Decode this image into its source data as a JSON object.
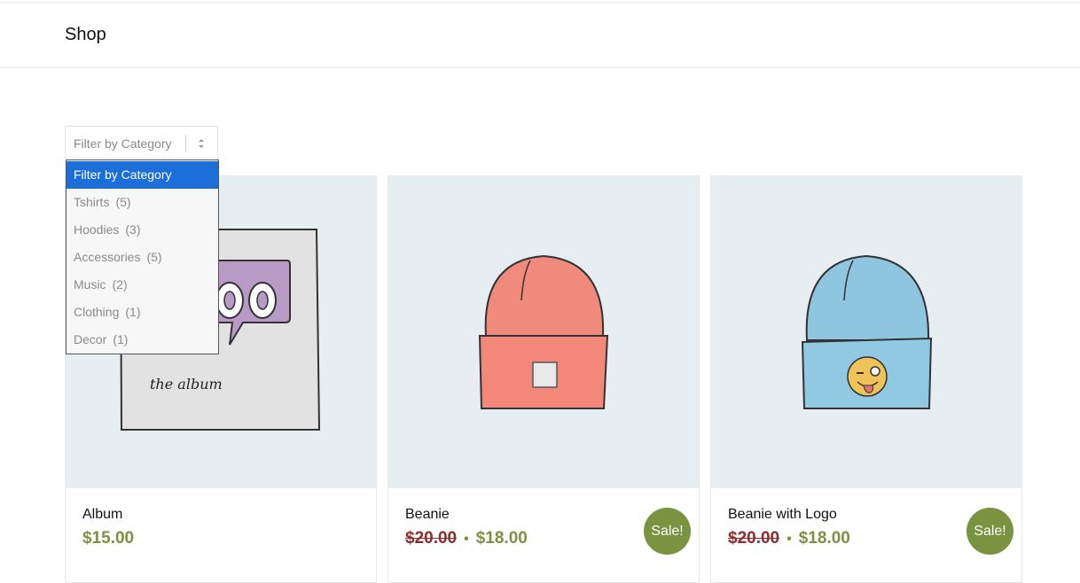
{
  "header": {
    "title": "Shop"
  },
  "filter": {
    "selected": "Filter by Category",
    "options": [
      {
        "label": "Filter by Category",
        "count": ""
      },
      {
        "label": "Tshirts",
        "count": "(5)"
      },
      {
        "label": "Hoodies",
        "count": "(3)"
      },
      {
        "label": "Accessories",
        "count": "(5)"
      },
      {
        "label": "Music",
        "count": "(2)"
      },
      {
        "label": "Clothing",
        "count": "(1)"
      },
      {
        "label": "Decor",
        "count": "(1)"
      }
    ]
  },
  "products": [
    {
      "name": "Album",
      "price": "$15.00",
      "old_price": "",
      "sale": "",
      "image_text": "the album"
    },
    {
      "name": "Beanie",
      "price": "$18.00",
      "old_price": "$20.00",
      "sale": "Sale!"
    },
    {
      "name": "Beanie with Logo",
      "price": "$18.00",
      "old_price": "$20.00",
      "sale": "Sale!"
    }
  ],
  "colors": {
    "accent": "#7a9340",
    "old_price": "#8c2c2c",
    "dropdown_selected": "#1c6ed8",
    "image_bg": "#e7eef2"
  }
}
